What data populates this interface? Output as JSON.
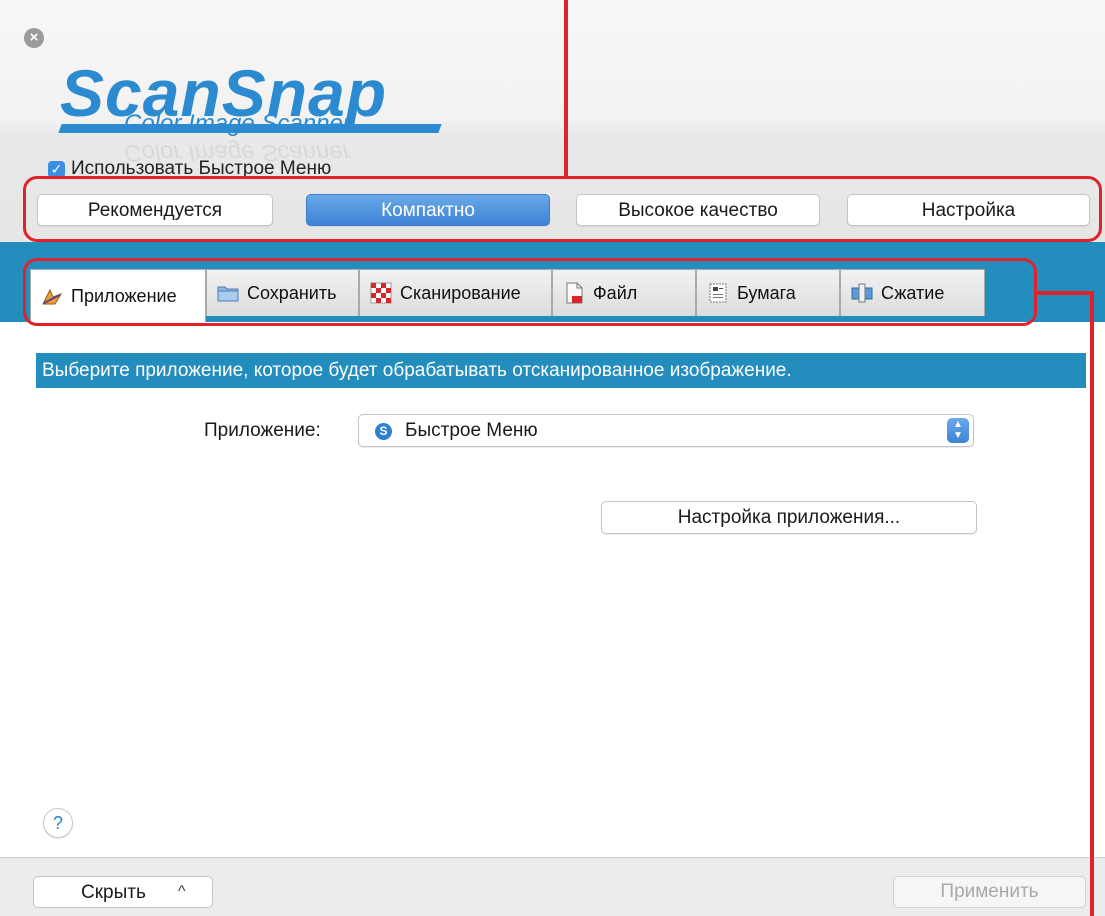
{
  "window": {
    "close_glyph": "×"
  },
  "logo": {
    "main": "ScanSnap",
    "sub": "Color Image Scanner"
  },
  "quick_menu": {
    "checked": true,
    "check_glyph": "✓",
    "label": "Использовать Быстрое Меню"
  },
  "modes": [
    "Рекомендуется",
    "Компактно",
    "Высокое качество",
    "Настройка"
  ],
  "selected_mode": "Компактно",
  "tabs": [
    {
      "label": "Приложение",
      "icon": "application-icon"
    },
    {
      "label": "Сохранить",
      "icon": "folder-icon"
    },
    {
      "label": "Сканирование",
      "icon": "scan-checker-icon"
    },
    {
      "label": "Файл",
      "icon": "file-icon"
    },
    {
      "label": "Бумага",
      "icon": "paper-icon"
    },
    {
      "label": "Сжатие",
      "icon": "compression-icon"
    }
  ],
  "active_tab": "Приложение",
  "main": {
    "prompt": "Выберите приложение, которое будет обрабатывать отсканированное изображение.",
    "application_label": "Приложение:",
    "application_value": "Быстрое Меню",
    "application_icon_glyph": "S",
    "stepper_up": "▲",
    "stepper_down": "▼",
    "settings_button": "Настройка приложения...",
    "help": "?"
  },
  "footer": {
    "hide": "Скрыть",
    "hide_chevron": "^",
    "apply": "Применить"
  },
  "colors": {
    "accent_blue": "#238dbe",
    "annotation_red": "#e0222a",
    "logo_blue": "#2c8bd0"
  }
}
